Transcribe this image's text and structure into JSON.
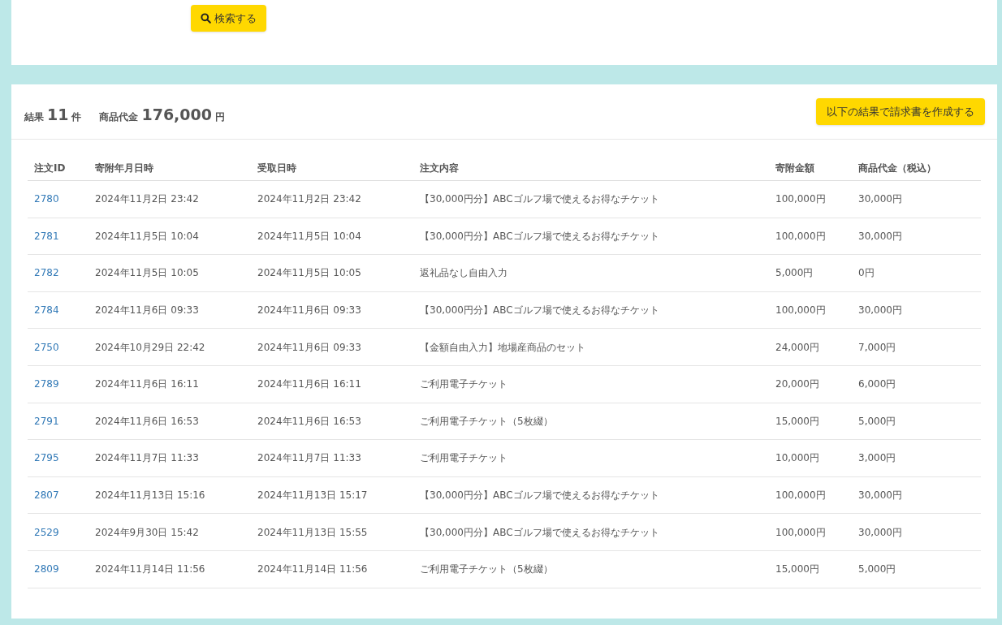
{
  "search_button": {
    "label": "検索する"
  },
  "summary": {
    "count_label": "結果",
    "count": "11",
    "count_unit": "件",
    "total_label": "商品代金",
    "total": "176,000",
    "total_unit": "円"
  },
  "invoice_button": {
    "label": "以下の結果で請求書を作成する"
  },
  "table": {
    "columns": [
      "注文ID",
      "寄附年月日時",
      "受取日時",
      "注文内容",
      "寄附金額",
      "商品代金（税込）"
    ],
    "rows": [
      [
        "2780",
        "2024年11月2日 23:42",
        "2024年11月2日 23:42",
        "【30,000円分】ABCゴルフ場で使えるお得なチケット",
        "100,000円",
        "30,000円"
      ],
      [
        "2781",
        "2024年11月5日 10:04",
        "2024年11月5日 10:04",
        "【30,000円分】ABCゴルフ場で使えるお得なチケット",
        "100,000円",
        "30,000円"
      ],
      [
        "2782",
        "2024年11月5日 10:05",
        "2024年11月5日 10:05",
        "返礼品なし自由入力",
        "5,000円",
        "0円"
      ],
      [
        "2784",
        "2024年11月6日 09:33",
        "2024年11月6日 09:33",
        "【30,000円分】ABCゴルフ場で使えるお得なチケット",
        "100,000円",
        "30,000円"
      ],
      [
        "2750",
        "2024年10月29日 22:42",
        "2024年11月6日 09:33",
        "【金額自由入力】地場産商品のセット",
        "24,000円",
        "7,000円"
      ],
      [
        "2789",
        "2024年11月6日 16:11",
        "2024年11月6日 16:11",
        "ご利用電子チケット",
        "20,000円",
        "6,000円"
      ],
      [
        "2791",
        "2024年11月6日 16:53",
        "2024年11月6日 16:53",
        "ご利用電子チケット（5枚綴）",
        "15,000円",
        "5,000円"
      ],
      [
        "2795",
        "2024年11月7日 11:33",
        "2024年11月7日 11:33",
        "ご利用電子チケット",
        "10,000円",
        "3,000円"
      ],
      [
        "2807",
        "2024年11月13日 15:16",
        "2024年11月13日 15:17",
        "【30,000円分】ABCゴルフ場で使えるお得なチケット",
        "100,000円",
        "30,000円"
      ],
      [
        "2529",
        "2024年9月30日 15:42",
        "2024年11月13日 15:55",
        "【30,000円分】ABCゴルフ場で使えるお得なチケット",
        "100,000円",
        "30,000円"
      ],
      [
        "2809",
        "2024年11月14日 11:56",
        "2024年11月14日 11:56",
        "ご利用電子チケット（5枚綴）",
        "15,000円",
        "5,000円"
      ]
    ]
  }
}
